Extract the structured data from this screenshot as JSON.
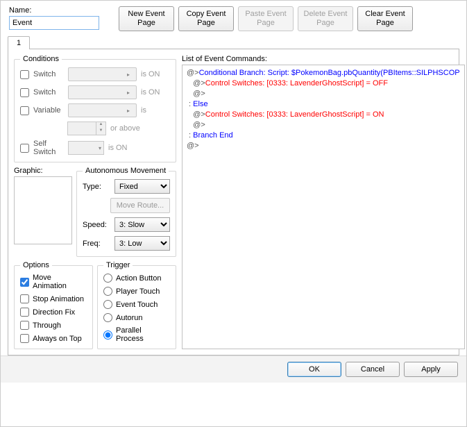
{
  "labels": {
    "name": "Name:",
    "conditions": "Conditions",
    "switch": "Switch",
    "variable": "Variable",
    "selfSwitch": "Self Switch",
    "isOn": "is ON",
    "is": "is",
    "orAbove": "or above",
    "graphic": "Graphic:",
    "autoMove": "Autonomous Movement",
    "type": "Type:",
    "moveRoute": "Move Route...",
    "speed": "Speed:",
    "freq": "Freq:",
    "options": "Options",
    "moveAnim": "Move Animation",
    "stopAnim": "Stop Animation",
    "dirFix": "Direction Fix",
    "through": "Through",
    "alwaysTop": "Always on Top",
    "trigger": "Trigger",
    "actionBtn": "Action Button",
    "playerTouch": "Player Touch",
    "eventTouch": "Event Touch",
    "autorun": "Autorun",
    "parallel": "Parallel Process",
    "listCmds": "List of Event Commands:"
  },
  "header": {
    "nameValue": "Event",
    "buttons": {
      "new": "New\nEvent Page",
      "copy": "Copy\nEvent Page",
      "paste": "Paste\nEvent Page",
      "delete": "Delete\nEvent Page",
      "clear": "Clear\nEvent Page"
    }
  },
  "tabs": [
    "1"
  ],
  "autoMove": {
    "type": "Fixed",
    "speed": "3: Slow",
    "freq": "3: Low"
  },
  "options": {
    "moveAnim": true,
    "stopAnim": false,
    "dirFix": false,
    "through": false,
    "alwaysTop": false
  },
  "triggerSelected": "parallel",
  "commands": [
    {
      "depth": 0,
      "prefix": "@>",
      "class": "blue",
      "text": "Conditional Branch: Script: $PokemonBag.pbQuantity(PBItems::SILPHSCOP"
    },
    {
      "depth": 1,
      "prefix": "@>",
      "class": "red",
      "text": "Control Switches: [0333: LavenderGhostScript] = OFF"
    },
    {
      "depth": 1,
      "prefix": "@>",
      "class": "",
      "text": ""
    },
    {
      "depth": 0,
      "prefix": " : ",
      "class": "blue",
      "text": "Else"
    },
    {
      "depth": 1,
      "prefix": "@>",
      "class": "red",
      "text": "Control Switches: [0333: LavenderGhostScript] = ON"
    },
    {
      "depth": 1,
      "prefix": "@>",
      "class": "",
      "text": ""
    },
    {
      "depth": 0,
      "prefix": " : ",
      "class": "blue",
      "text": "Branch End"
    },
    {
      "depth": 0,
      "prefix": "@>",
      "class": "",
      "text": ""
    }
  ],
  "footer": {
    "ok": "OK",
    "cancel": "Cancel",
    "apply": "Apply"
  }
}
